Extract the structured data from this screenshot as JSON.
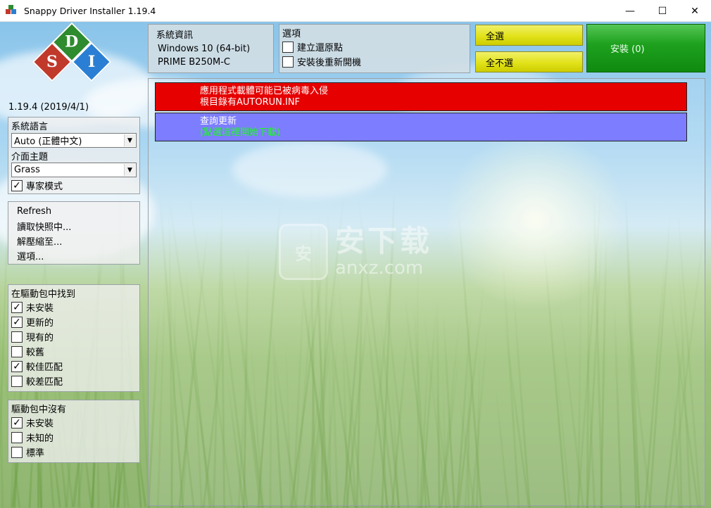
{
  "window": {
    "title": "Snappy Driver Installer 1.19.4",
    "controls": {
      "minimize": "—",
      "maximize": "☐",
      "close": "✕"
    }
  },
  "logo": {
    "letters": [
      "D",
      "S",
      "I"
    ]
  },
  "version": "1.19.4 (2019/4/1)",
  "language_box": {
    "title": "系統語言",
    "language_value": "Auto (正體中文)",
    "theme_title": "介面主題",
    "theme_value": "Grass",
    "expert_mode_label": "專家模式",
    "expert_mode_checked": true
  },
  "actions_menu": {
    "items": [
      "Refresh",
      "讀取快照中...",
      "解壓縮至...",
      "選項..."
    ]
  },
  "found_in_pack": {
    "title": "在驅動包中找到",
    "items": [
      {
        "label": "未安裝",
        "checked": true
      },
      {
        "label": "更新的",
        "checked": true
      },
      {
        "label": "現有的",
        "checked": false
      },
      {
        "label": "較舊",
        "checked": false
      },
      {
        "label": "較佳匹配",
        "checked": true
      },
      {
        "label": "較差匹配",
        "checked": false
      }
    ]
  },
  "not_in_pack": {
    "title": "驅動包中沒有",
    "items": [
      {
        "label": "未安裝",
        "checked": true
      },
      {
        "label": "未知的",
        "checked": false
      },
      {
        "label": "標準",
        "checked": false
      }
    ]
  },
  "system_info": {
    "title": "系統資訊",
    "os": "Windows 10 (64-bit)",
    "board": "PRIME B250M-C"
  },
  "options": {
    "title": "選項",
    "items": [
      {
        "label": "建立還原點",
        "checked": false
      },
      {
        "label": "安裝後重新開機",
        "checked": false
      }
    ]
  },
  "buttons": {
    "select_all": "全選",
    "select_none": "全不選",
    "install": "安裝 (0)"
  },
  "rows": {
    "virus_warning_line1": "應用程式載體可能已被病毒入侵",
    "virus_warning_line2": "根目錄有AUTORUN.INF",
    "update_title": "查詢更新",
    "update_sub": "(點選這裡開始下載)"
  },
  "watermark": {
    "big": "安下载",
    "small": "anxz.com",
    "badge": "安"
  },
  "colors": {
    "warning_row": "#e60000",
    "update_row": "#7d7dff",
    "update_sub_text": "#19ff19",
    "install_button": "#1fa21f",
    "select_buttons": "#e2e21a"
  }
}
